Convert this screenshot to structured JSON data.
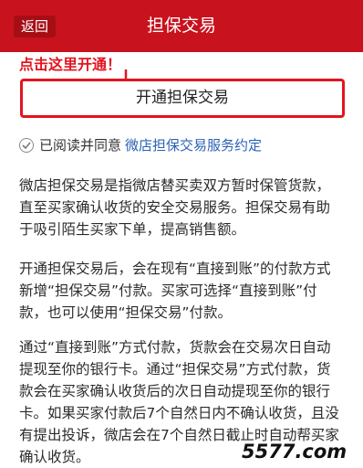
{
  "header": {
    "back_label": "返回",
    "title": "担保交易"
  },
  "annotation": {
    "text": "点击这里开通！",
    "color": "#e3141e"
  },
  "main": {
    "open_button_label": "开通担保交易",
    "agreement": {
      "prefix": "已阅读并同意",
      "link": "微店担保交易服务约定",
      "checked": true
    },
    "paragraphs": [
      "微店担保交易是指微店替买卖双方暂时保管货款，直至买家确认收货的安全交易服务。担保交易有助于吸引陌生买家下单，提高销售额。",
      "开通担保交易后，会在现有“直接到账”的付款方式新增“担保交易”付款。买家可选择“直接到账”付款，也可以使用“担保交易”付款。",
      "通过“直接到账”方式付款，货款会在交易次日自动提现至你的银行卡。通过“担保交易”方式付款，货款会在买家确认收货后的次日自动提现至你的银行卡。如果买家付款后7个自然日内不确认收货，且没有提出投诉，微店会在7个自然日截止时自动帮买家确认收货。"
    ]
  },
  "watermark": {
    "text": "5577.com"
  },
  "colors": {
    "header_bg": "#c8121e",
    "accent_red": "#e3141e",
    "link": "#2a62b5"
  }
}
